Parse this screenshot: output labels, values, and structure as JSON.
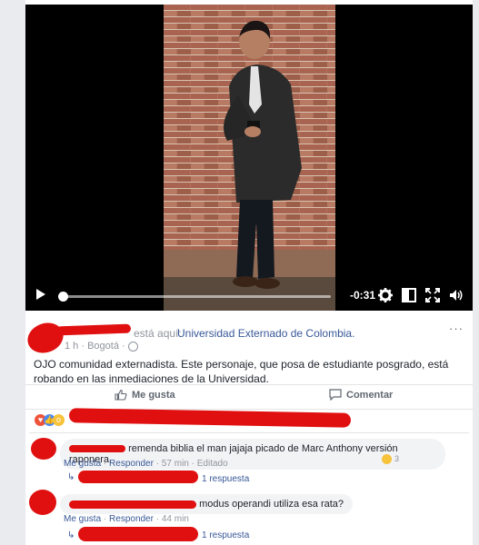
{
  "video": {
    "time_remaining": "-0:31",
    "icons": [
      "play-icon",
      "settings-gear-icon",
      "picture-in-picture-icon",
      "fullscreen-icon",
      "volume-icon"
    ]
  },
  "post": {
    "is_here_text": "está aquí:",
    "place": "Universidad Externado de Colombia.",
    "time": "1 h · Bogotá ·",
    "body": "OJO comunidad externadista. Este personaje, que posa de estudiante posgrado, está robando en las inmediaciones de la Universidad.",
    "menu": "···"
  },
  "actions": {
    "like": "Me gusta",
    "comment": "Comentar"
  },
  "comments": [
    {
      "text": "remenda biblia el man jajaja picado de Marc Anthony versión raponera.",
      "like": "Me gusta",
      "reply": "Responder",
      "time": "· 57 min · Editado",
      "reaction_count": "3",
      "replies_label": "1 respuesta"
    },
    {
      "text": "modus operandi utiliza esa rata?",
      "like": "Me gusta",
      "reply": "Responder",
      "time": "· 44 min",
      "replies_label": "1 respuesta"
    }
  ],
  "colors": {
    "link": "#385898",
    "redaction": "#e01010",
    "meta": "#90949c"
  }
}
